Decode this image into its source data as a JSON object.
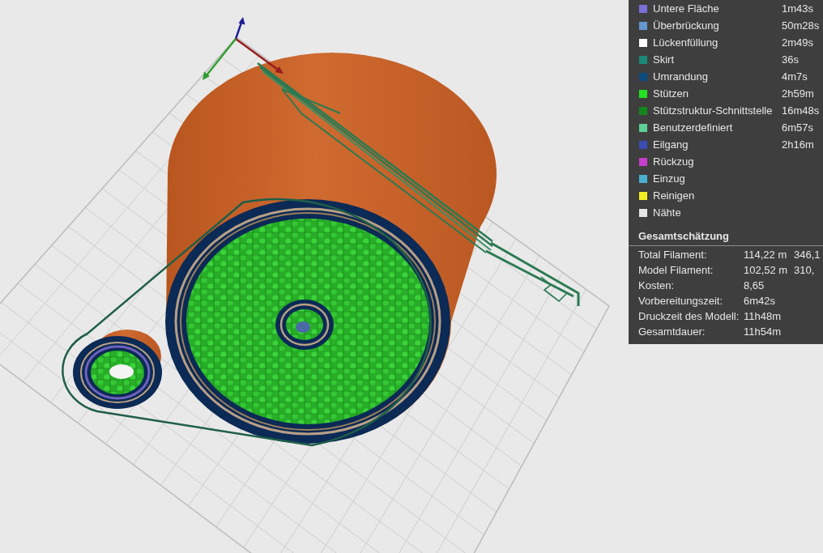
{
  "legend": {
    "items": [
      {
        "label": "Untere Fläche",
        "time": "1m43s",
        "color": "#7b6fd8"
      },
      {
        "label": "Überbrückung",
        "time": "50m28s",
        "color": "#6496d0"
      },
      {
        "label": "Lückenfüllung",
        "time": "2m49s",
        "color": "#ffffff"
      },
      {
        "label": "Skirt",
        "time": "36s",
        "color": "#1b8a78"
      },
      {
        "label": "Umrandung",
        "time": "4m7s",
        "color": "#0c4b80"
      },
      {
        "label": "Stützen",
        "time": "2h59m",
        "color": "#22e022"
      },
      {
        "label": "Stützstruktur-Schnittstelle",
        "time": "16m48s",
        "color": "#12871a"
      },
      {
        "label": "Benutzerdefiniert",
        "time": "6m57s",
        "color": "#5ecf95"
      },
      {
        "label": "Eilgang",
        "time": "2h16m",
        "color": "#3a4db5"
      },
      {
        "label": "Rückzug",
        "color": "#c83ccb"
      },
      {
        "label": "Einzug",
        "color": "#4ab0d0"
      },
      {
        "label": "Reinigen",
        "color": "#f5f020"
      },
      {
        "label": "Nähte",
        "color": "#e6e6e6"
      }
    ]
  },
  "summary": {
    "title": "Gesamtschätzung",
    "rows": [
      {
        "label": "Total Filament:",
        "value": "114,22 m",
        "column_3": "346,1"
      },
      {
        "label": "Model Filament:",
        "value": "102,52 m",
        "column_3": "310,"
      },
      {
        "label": "Kosten:",
        "value": "8,65"
      },
      {
        "label": "Vorbereitungszeit:",
        "value": "6m42s"
      },
      {
        "label": "Druckzeit des Modell:",
        "value": "11h48m"
      },
      {
        "label": "Gesamtdauer:",
        "value": "11h54m"
      }
    ]
  }
}
